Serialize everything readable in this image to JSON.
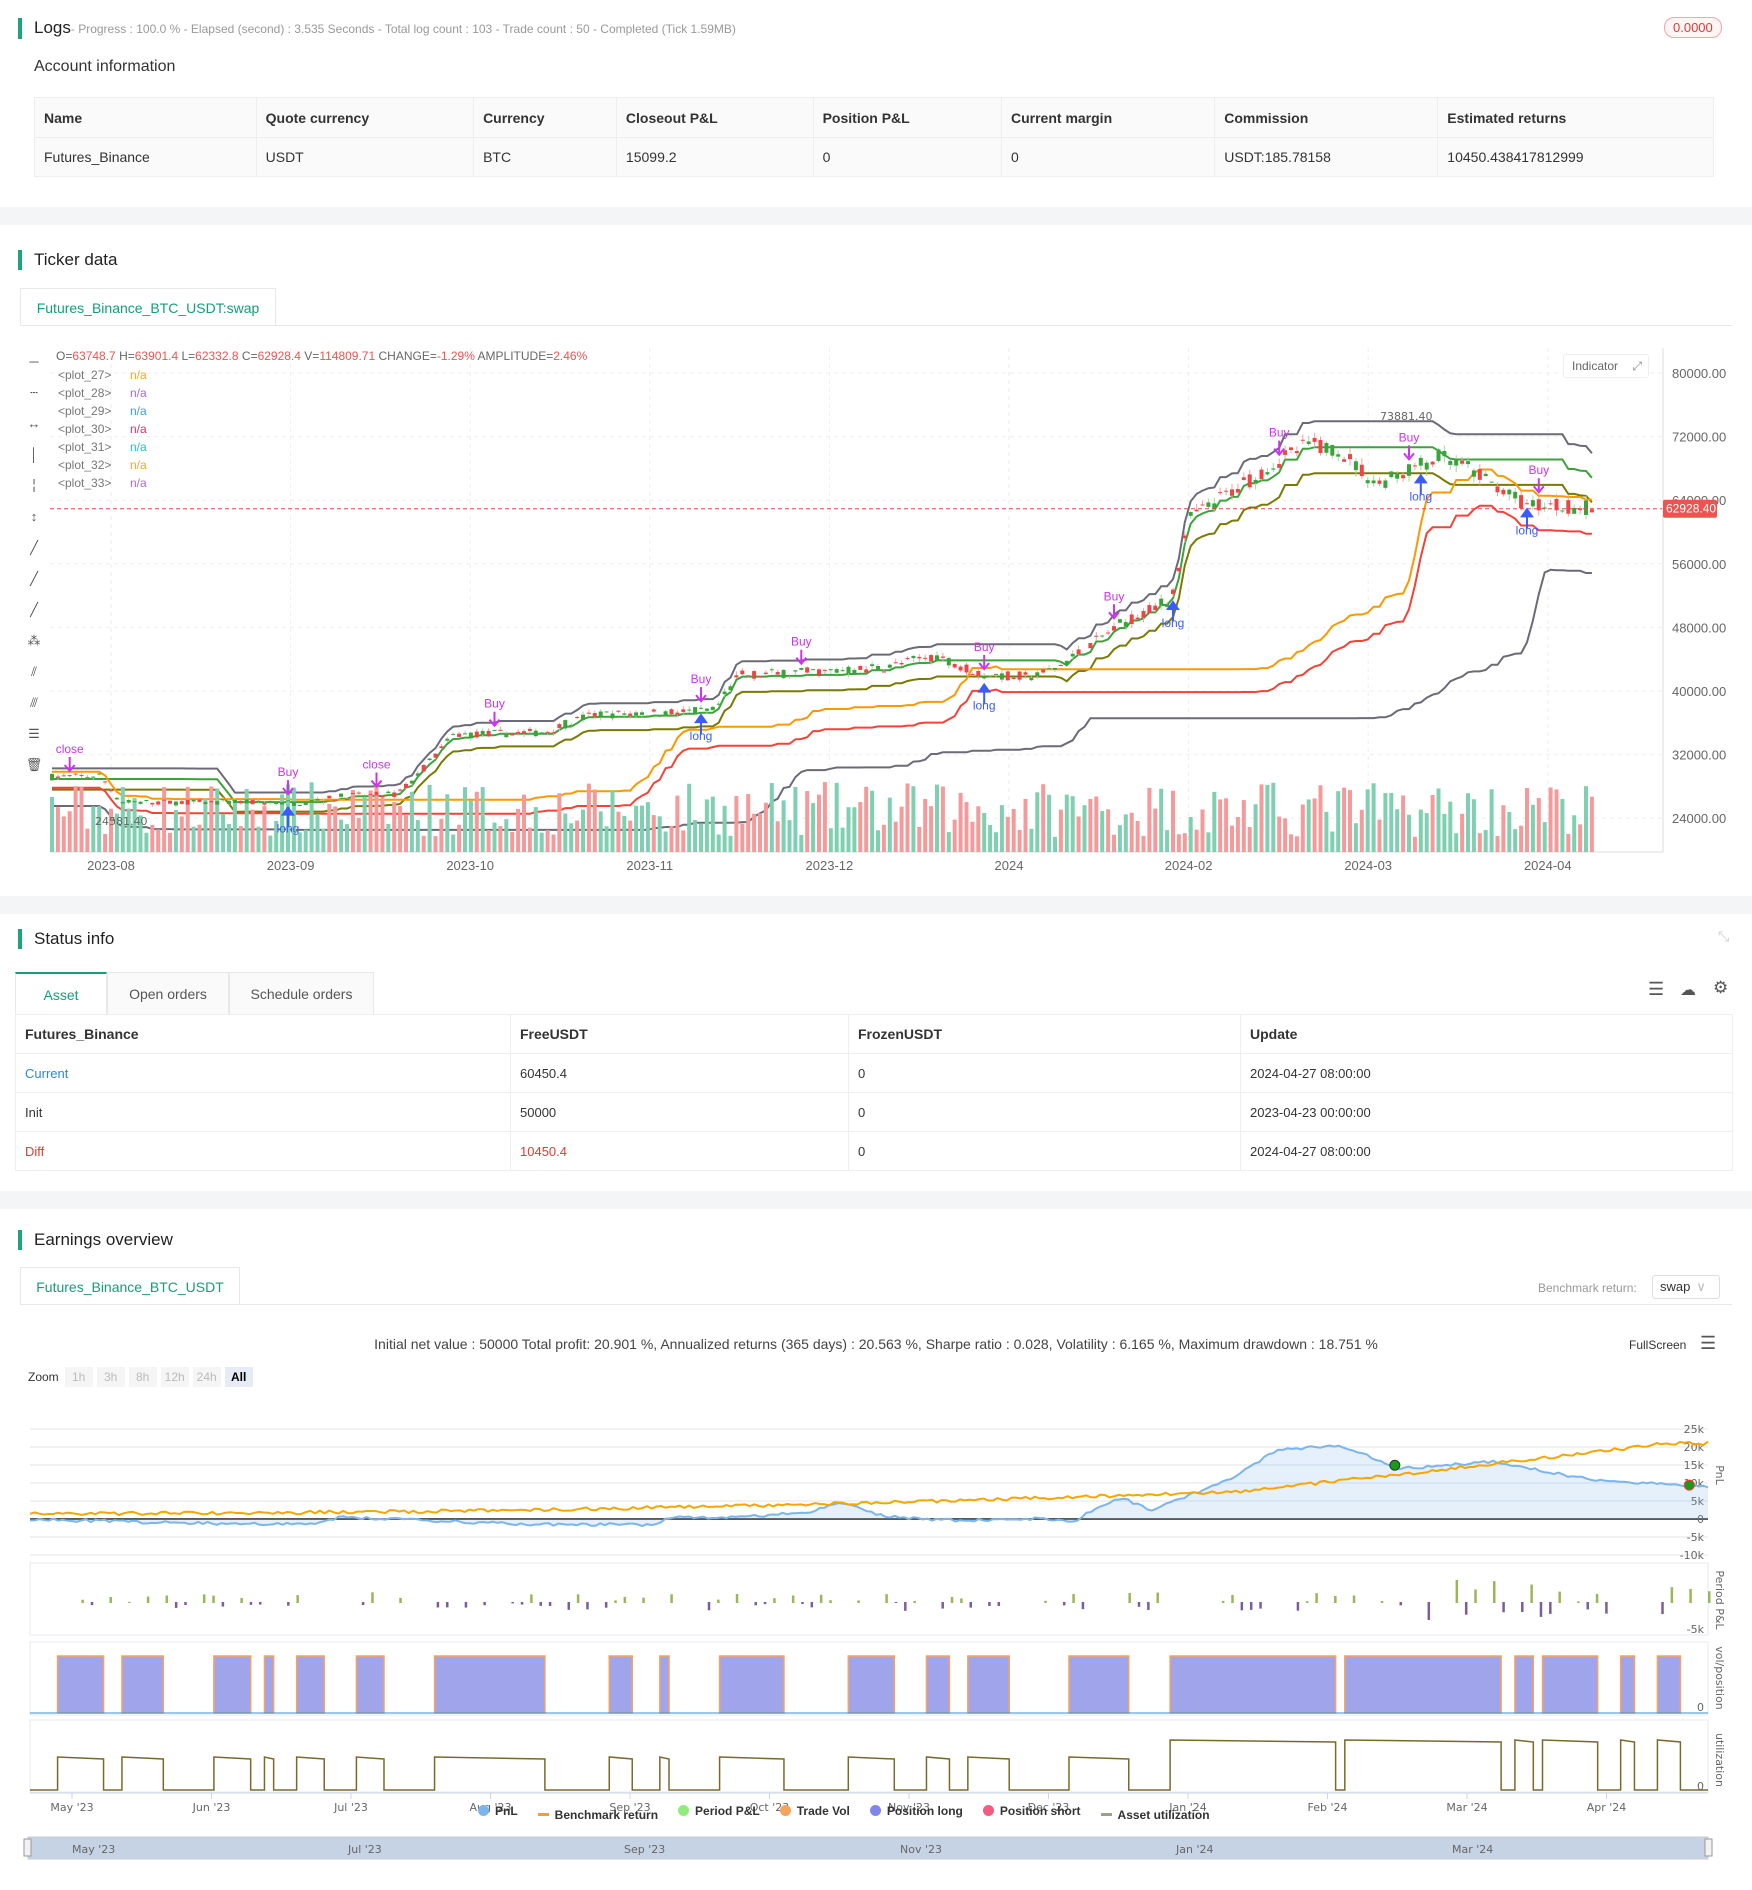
{
  "logs": {
    "title": "Logs",
    "summary": "- Progress : 100.0 % - Elapsed (second) : 3.535  Seconds - Total log count : 103 - Trade count : 50 - Completed (Tick 1.59MB)",
    "badge": "0.0000"
  },
  "account": {
    "title": "Account information",
    "headers": [
      "Name",
      "Quote currency",
      "Currency",
      "Closeout P&L",
      "Position P&L",
      "Current margin",
      "Commission",
      "Estimated returns"
    ],
    "row": [
      "Futures_Binance",
      "USDT",
      "BTC",
      "15099.2",
      "0",
      "0",
      "USDT:185.78158",
      "10450.438417812999"
    ]
  },
  "ticker": {
    "title": "Ticker data",
    "tab": "Futures_Binance_BTC_USDT:swap",
    "indicator_button": "Indicator",
    "ohlc": {
      "o_label": "O=",
      "o": "63748.7",
      "h_label": " H=",
      "h": "63901.4",
      "l_label": " L=",
      "l": "62332.8",
      "c_label": " C=",
      "c": "62928.4",
      "v_label": " V=",
      "v": "114809.71",
      "chg_label": " CHANGE=",
      "chg": "-1.29%",
      "amp_label": " AMPLITUDE=",
      "amp": "2.46%"
    },
    "plots": [
      {
        "name": "<plot_27>",
        "value": "n/a",
        "color": "#f5a623"
      },
      {
        "name": "<plot_28>",
        "value": "n/a",
        "color": "#a66bd3"
      },
      {
        "name": "<plot_29>",
        "value": "n/a",
        "color": "#3a9be0"
      },
      {
        "name": "<plot_30>",
        "value": "n/a",
        "color": "#d6336c"
      },
      {
        "name": "<plot_31>",
        "value": "n/a",
        "color": "#22c3c3"
      },
      {
        "name": "<plot_32>",
        "value": "n/a",
        "color": "#f5a623"
      },
      {
        "name": "<plot_33>",
        "value": "n/a",
        "color": "#a66bd3"
      }
    ],
    "price_axis": [
      "80000.00",
      "72000.00",
      "64000.00",
      "56000.00",
      "48000.00",
      "40000.00",
      "32000.00",
      "24000.00"
    ],
    "last_price": "62928.40",
    "high_label": "73881.40",
    "low_label": "24581.40",
    "date_axis": [
      "2023-08",
      "2023-09",
      "2023-10",
      "2023-11",
      "2023-12",
      "2024",
      "2024-02",
      "2024-03",
      "2024-04"
    ],
    "signals": [
      {
        "bar": 3,
        "text": "close",
        "type": "close"
      },
      {
        "bar": 40,
        "text": "Buy",
        "type": "buy"
      },
      {
        "bar": 55,
        "text": "close",
        "type": "close"
      },
      {
        "bar": 75,
        "text": "Buy",
        "type": "buy"
      },
      {
        "bar": 110,
        "text": "Buy",
        "type": "buy"
      },
      {
        "bar": 127,
        "text": "Buy",
        "type": "buy"
      },
      {
        "bar": 158,
        "text": "Buy",
        "type": "buy"
      },
      {
        "bar": 180,
        "text": "Buy",
        "type": "buy"
      },
      {
        "bar": 208,
        "text": "Buy",
        "type": "buy"
      },
      {
        "bar": 230,
        "text": "Buy",
        "type": "buy"
      },
      {
        "bar": 252,
        "text": "Buy",
        "type": "buy"
      },
      {
        "bar": 40,
        "text": "long",
        "type": "long"
      },
      {
        "bar": 110,
        "text": "long",
        "type": "long"
      },
      {
        "bar": 158,
        "text": "long",
        "type": "long"
      },
      {
        "bar": 190,
        "text": "long",
        "type": "long"
      },
      {
        "bar": 232,
        "text": "long",
        "type": "long"
      },
      {
        "bar": 250,
        "text": "long",
        "type": "long"
      }
    ]
  },
  "status": {
    "title": "Status info",
    "tabs": [
      "Asset",
      "Open orders",
      "Schedule orders"
    ],
    "headers": [
      "Futures_Binance",
      "FreeUSDT",
      "FrozenUSDT",
      "Update"
    ],
    "rows": [
      [
        "Current",
        "60450.4",
        "0",
        "2024-04-27 08:00:00"
      ],
      [
        "Init",
        "50000",
        "0",
        "2023-04-23 00:00:00"
      ],
      [
        "Diff",
        "10450.4",
        "0",
        "2024-04-27 08:00:00"
      ]
    ]
  },
  "earnings": {
    "title": "Earnings overview",
    "tab": "Futures_Binance_BTC_USDT",
    "benchmark_label": "Benchmark return:",
    "benchmark_value": "swap",
    "stats": "Initial net value : 50000 Total profit: 20.901 %, Annualized returns (365 days) : 20.563 %, Sharpe ratio : 0.028, Volatility : 6.165 %, Maximum drawdown : 18.751 %",
    "fullscreen": "FullScreen",
    "zoom_label": "Zoom",
    "zoom_options": [
      "1h",
      "3h",
      "8h",
      "12h",
      "24h",
      "All"
    ],
    "pnl_axis": [
      "25k",
      "20k",
      "15k",
      "10k",
      "5k",
      "0",
      "-5k",
      "-10k"
    ],
    "period_axis": "-5k",
    "zero": "0",
    "panel_labels": [
      "PnL",
      "Period P&L",
      "vol/position",
      "utilization"
    ],
    "x_axis": [
      "May '23",
      "Jun '23",
      "Jul '23",
      "Aug '23",
      "Sep '23",
      "Oct '23",
      "Nov '23",
      "Dec '23",
      "Jan '24",
      "Feb '24",
      "Mar '24",
      "Apr '24"
    ],
    "legend": [
      {
        "label": "PnL",
        "color": "#7cb5ec"
      },
      {
        "label": "Benchmark return",
        "color": "#f7a600"
      },
      {
        "label": "Period P&L",
        "color": "#90ed7d"
      },
      {
        "label": "Trade Vol",
        "color": "#f7a35c"
      },
      {
        "label": "Position long",
        "color": "#8085e9"
      },
      {
        "label": "Position short",
        "color": "#f15c80"
      },
      {
        "label": "Asset utilization",
        "color": "#a0a080"
      }
    ],
    "navigator": [
      "May '23",
      "Jul '23",
      "Sep '23",
      "Nov '23",
      "Jan '24",
      "Mar '24"
    ]
  }
}
